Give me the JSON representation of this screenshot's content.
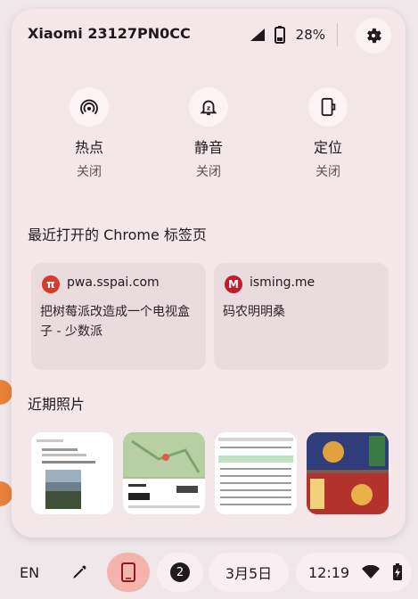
{
  "header": {
    "device_name": "Xiaomi 23127PN0CC",
    "battery_percent": "28%",
    "signal_icon": "cellular-signal-icon",
    "battery_icon": "battery-icon",
    "settings_icon": "gear-icon"
  },
  "tiles": [
    {
      "icon": "hotspot-icon",
      "label": "热点",
      "state": "关闭"
    },
    {
      "icon": "silent-bell-icon",
      "label": "静音",
      "state": "关闭"
    },
    {
      "icon": "location-phone-icon",
      "label": "定位",
      "state": "关闭"
    }
  ],
  "recent_tabs": {
    "title": "最近打开的 Chrome 标签页",
    "items": [
      {
        "domain": "pwa.sspai.com",
        "favicon_letter": "π",
        "favicon_color": "#d83a2a",
        "title": "把树莓派改造成一个电视盒子 - 少数派"
      },
      {
        "domain": "isming.me",
        "favicon_letter": "M",
        "favicon_color": "#c51a2b",
        "title": "码农明明桑"
      }
    ]
  },
  "recent_photos": {
    "title": "近期照片",
    "count": 4
  },
  "shelf": {
    "ime": "EN",
    "notification_count": "2",
    "date": "3月5日",
    "time": "12:19"
  }
}
